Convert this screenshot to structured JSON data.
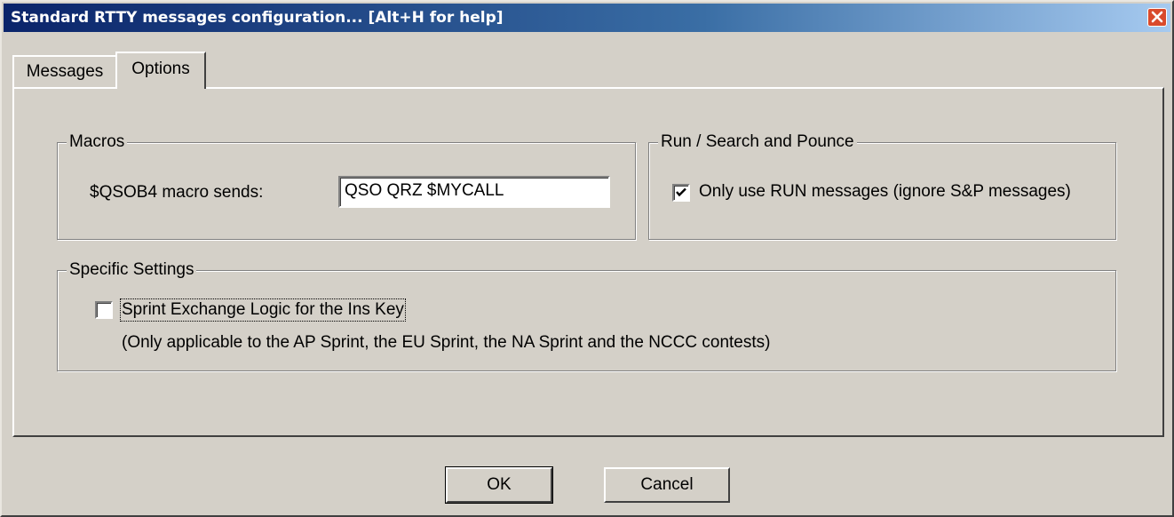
{
  "window": {
    "title": "Standard RTTY messages configuration... [Alt+H for help]",
    "close_icon": "close-icon"
  },
  "tabs": [
    {
      "label": "Messages",
      "selected": false
    },
    {
      "label": "Options",
      "selected": true
    }
  ],
  "macros": {
    "legend": "Macros",
    "qsob4_label": "$QSOB4 macro sends:",
    "qsob4_value": "QSO QRZ $MYCALL"
  },
  "run_sp": {
    "legend": "Run / Search and Pounce",
    "only_run_label": "Only use RUN messages (ignore S&P messages)",
    "only_run_checked": true
  },
  "specific": {
    "legend": "Specific Settings",
    "sprint_label": "Sprint Exchange Logic for the Ins Key",
    "sprint_checked": false,
    "note": "(Only applicable to the AP Sprint, the EU Sprint, the NA Sprint and the NCCC contests)"
  },
  "buttons": {
    "ok": "OK",
    "cancel": "Cancel"
  }
}
